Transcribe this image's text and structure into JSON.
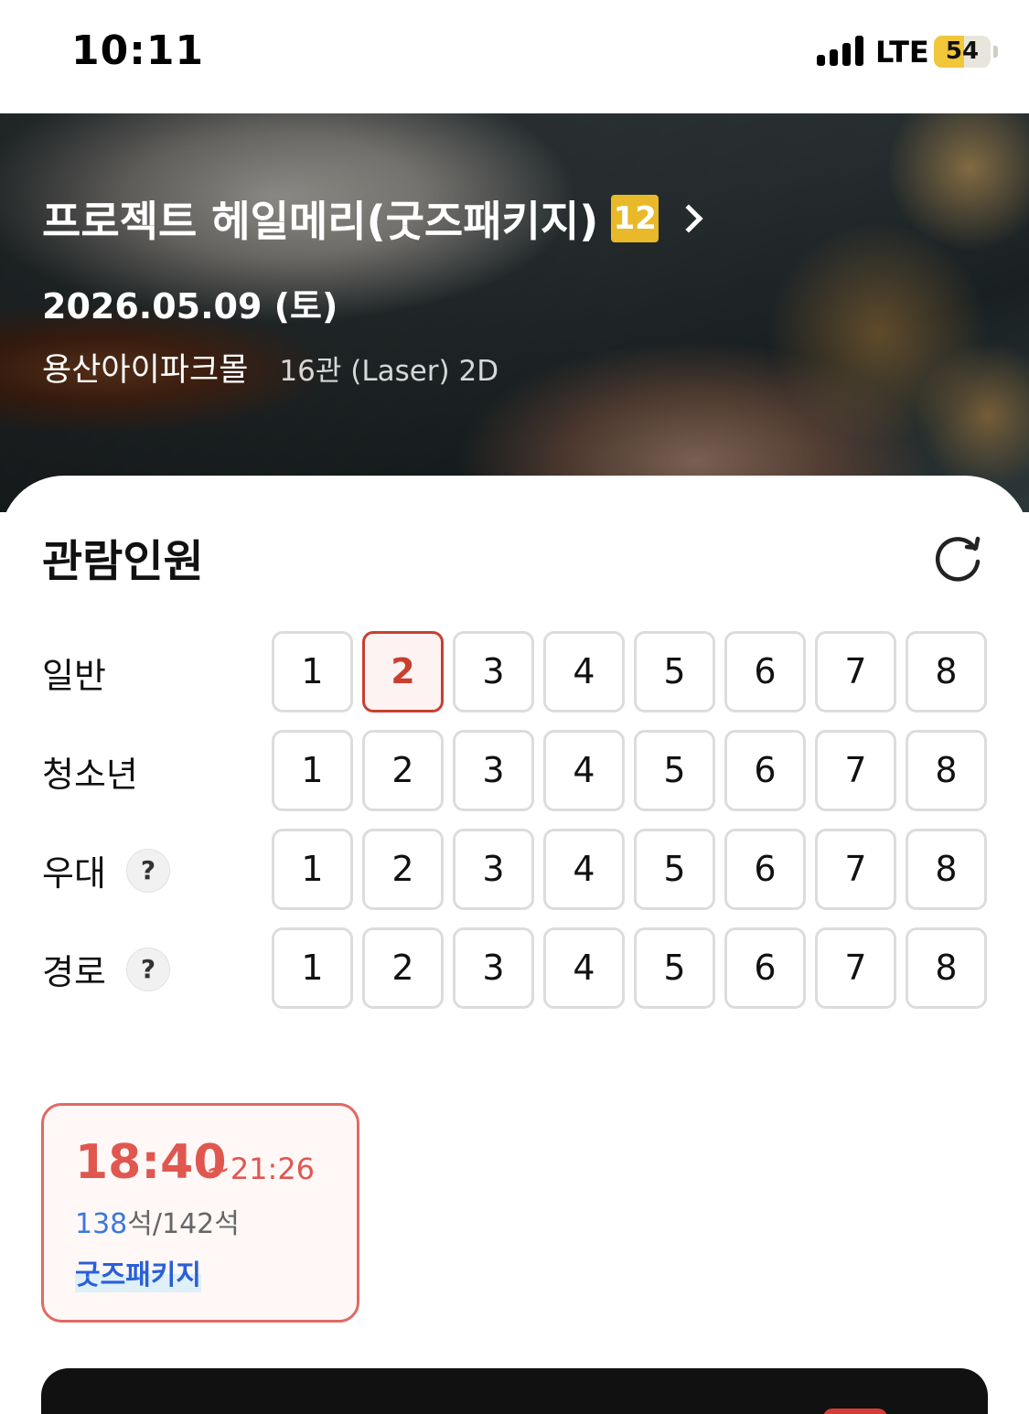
{
  "status_bar": {
    "time": "10:11",
    "network": "LTE",
    "battery": "54",
    "battery_level": 0.54
  },
  "movie": {
    "title": "프로젝트 헤일메리(굿즈패키지)",
    "rating": "12",
    "date": "2026.05.09 (토)",
    "theater": "용산아이파크몰",
    "screen": "16관 (Laser) 2D"
  },
  "audience": {
    "title": "관람인원",
    "rows": [
      {
        "label": "일반",
        "selected": 2,
        "help": false
      },
      {
        "label": "청소년",
        "selected": null,
        "help": false
      },
      {
        "label": "우대",
        "selected": null,
        "help": true
      },
      {
        "label": "경로",
        "selected": null,
        "help": true
      }
    ],
    "numbers": [
      "1",
      "2",
      "3",
      "4",
      "5",
      "6",
      "7",
      "8"
    ],
    "help_symbol": "?"
  },
  "showtime": {
    "start": "18:40",
    "end": "~21:26",
    "seats_available": "138",
    "seats_available_unit": "석",
    "seats_total": "/142석",
    "tag": "굿즈패키지"
  },
  "icons": {
    "rating_badge": "rating-12-icon",
    "chevron": "chevron-right-icon",
    "refresh": "refresh-icon",
    "help": "question-icon"
  },
  "colors": {
    "accent": "#c8402f",
    "showtime_accent": "#e05750",
    "rating_badge": "#e9b92a",
    "seats_available": "#3a78e0",
    "package_tag": "#2a5fd8"
  }
}
